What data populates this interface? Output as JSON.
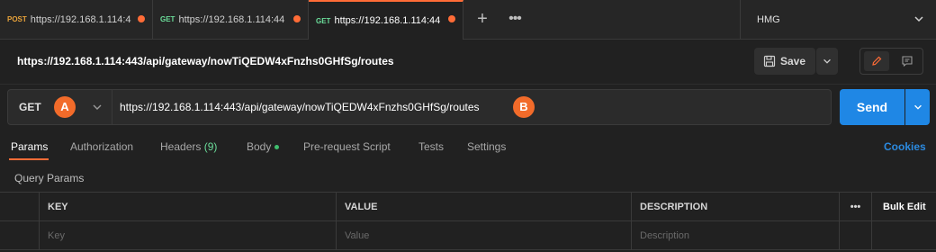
{
  "tabs": [
    {
      "method": "POST",
      "url": "https://192.168.1.114:4",
      "active": false
    },
    {
      "method": "GET",
      "url": "https://192.168.1.114:44",
      "active": false
    },
    {
      "method": "GET",
      "url": "https://192.168.1.114:44",
      "active": true
    }
  ],
  "tab_actions": {
    "new_tab_icon": "plus-icon",
    "more_icon": "more-horizontal-icon"
  },
  "environment": {
    "name": "HMG",
    "icon": "chevron-down-icon"
  },
  "request": {
    "title": "https://192.168.1.114:443/api/gateway/nowTiQEDW4xFnzhs0GHfSg/routes",
    "save_label": "Save",
    "method": "GET",
    "url": "https://192.168.1.114:443/api/gateway/nowTiQEDW4xFnzhs0GHfSg/routes",
    "send_label": "Send"
  },
  "annotations": {
    "a": "A",
    "b": "B"
  },
  "subtabs": [
    {
      "label": "Params",
      "active": true
    },
    {
      "label": "Authorization"
    },
    {
      "label": "Headers",
      "count": "(9)"
    },
    {
      "label": "Body"
    },
    {
      "label": "Pre-request Script"
    },
    {
      "label": "Tests"
    },
    {
      "label": "Settings"
    }
  ],
  "cookies_label": "Cookies",
  "query_params": {
    "label": "Query Params",
    "columns": [
      "KEY",
      "VALUE",
      "DESCRIPTION"
    ],
    "more_label": "•••",
    "bulk_edit_label": "Bulk Edit",
    "placeholders": {
      "key": "Key",
      "value": "Value",
      "description": "Description"
    }
  },
  "colors": {
    "accent": "#ff6c37",
    "send": "#1f87e5",
    "get": "#6bdd9a",
    "post": "#e8a23a",
    "link": "#2b8ae0"
  }
}
